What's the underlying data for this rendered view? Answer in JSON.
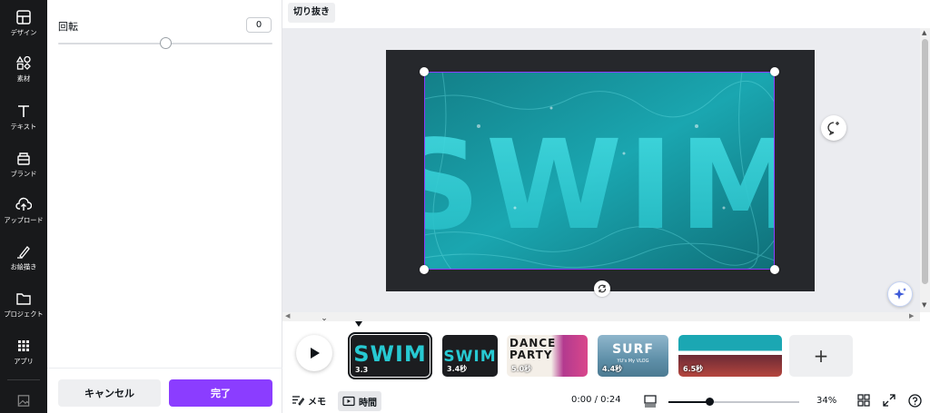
{
  "sidebar": {
    "items": [
      {
        "label": "デザイン",
        "icon": "layout-icon"
      },
      {
        "label": "素材",
        "icon": "shapes-icon"
      },
      {
        "label": "テキスト",
        "icon": "text-icon"
      },
      {
        "label": "ブランド",
        "icon": "brand-icon"
      },
      {
        "label": "アップロード",
        "icon": "upload-icon"
      },
      {
        "label": "お絵描き",
        "icon": "draw-icon"
      },
      {
        "label": "プロジェクト",
        "icon": "folder-icon"
      },
      {
        "label": "アプリ",
        "icon": "apps-icon"
      }
    ]
  },
  "panel": {
    "rotation_label": "回転",
    "rotation_value": "0",
    "rotation_slider_fraction": 0.5,
    "cancel_label": "キャンセル",
    "done_label": "完了"
  },
  "toolbar": {
    "crop_label": "切り抜き"
  },
  "canvas": {
    "image_text": "SWIM"
  },
  "timeline": {
    "clips": [
      {
        "title": "SWIM",
        "duration": "3.3",
        "selected": true
      },
      {
        "title": "SWIM",
        "duration": "3.4秒"
      },
      {
        "title": "DANCE PARTY",
        "duration": "5.0秒"
      },
      {
        "title": "SURF",
        "subtitle": "YU's My VLOG",
        "duration": "4.4秒"
      },
      {
        "title": "",
        "duration": "6.5秒"
      }
    ],
    "add_label": "+"
  },
  "bottombar": {
    "memo_label": "メモ",
    "time_label": "時間",
    "clock": "0:00 / 0:24",
    "zoom": "34%"
  },
  "colors": {
    "accent": "#8b3dff",
    "rail_bg": "#18191b",
    "canvas_bg": "#ebecf0",
    "water": "#1fb3bd"
  }
}
